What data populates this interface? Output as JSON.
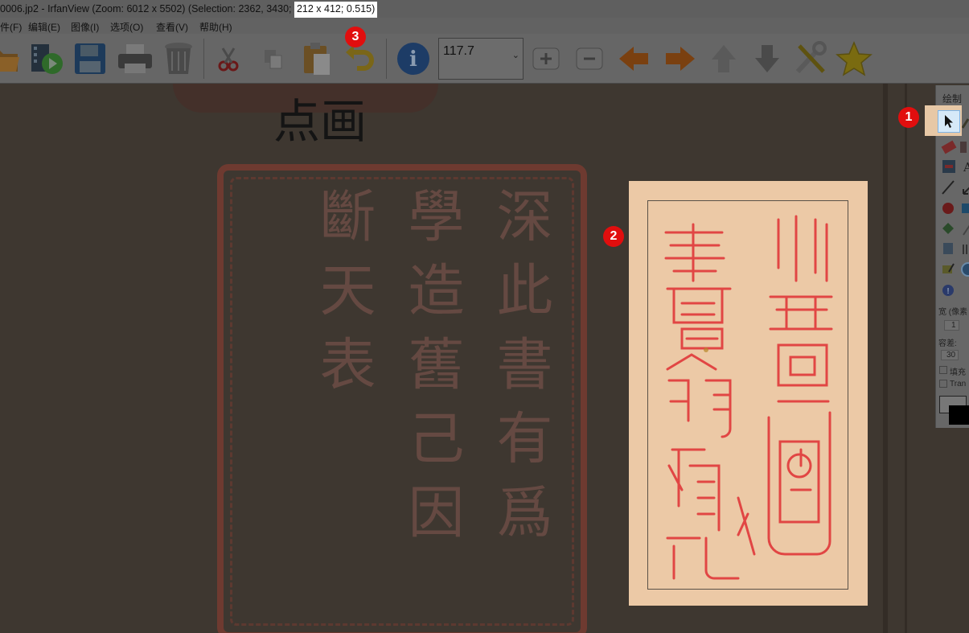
{
  "titlebar": {
    "title": "0006.jp2 - IrfanView (Zoom: 6012 x 5502) (Selection: 2362, 3430; ",
    "selection_highlight": "212 x 412; 0.515)"
  },
  "menubar": {
    "items": [
      "件(F)",
      "编辑(E)",
      "图像(I)",
      "选项(O)",
      "查看(V)",
      "帮助(H)"
    ]
  },
  "toolbar": {
    "zoom_value": "117.7",
    "buttons": [
      "open-folder",
      "slideshow",
      "save",
      "print",
      "delete",
      "cut",
      "copy",
      "paste",
      "undo",
      "info",
      "zoom-in",
      "zoom-out",
      "previous",
      "next",
      "first",
      "last",
      "properties",
      "favorites"
    ]
  },
  "canvas": {
    "top_handwriting": "点画",
    "large_seal_text": "深此書有爲學造舊己因斷天表"
  },
  "palette": {
    "title": "绘制",
    "width_label": "宽 (像素",
    "width_value": "1",
    "tolerance_label": "容差:",
    "tolerance_value": "30",
    "fill_label": "填充",
    "transparent_label": "Tran"
  },
  "markers": [
    "1",
    "2",
    "3"
  ],
  "colors": {
    "marker": "#e10e0e",
    "seal_red": "#e0383a",
    "seal_paper": "#ecc9a6",
    "selection_highlight": "#ffffff"
  }
}
